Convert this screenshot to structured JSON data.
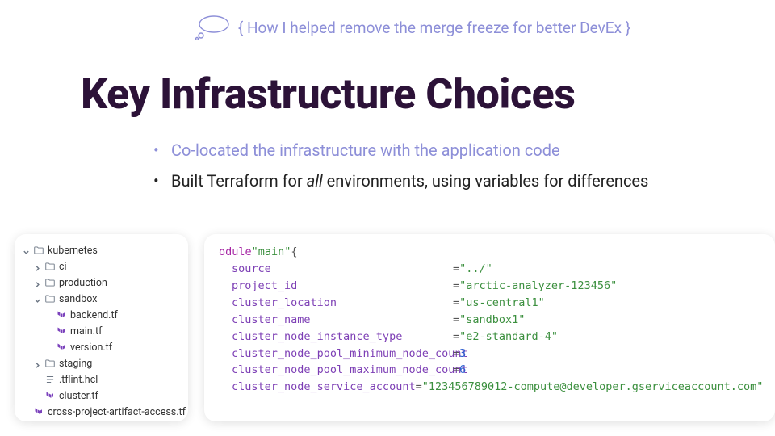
{
  "subtitle": "{ How I helped remove the merge freeze for better DevEx }",
  "title": "Key Infrastructure Choices",
  "bullets": [
    {
      "text": "Co-located the infrastructure with the application code",
      "muted": true
    },
    {
      "html": "Built Terraform for <em>all</em> environments, using variables for differences",
      "muted": false
    }
  ],
  "tree": [
    {
      "depth": 0,
      "chev": "down",
      "icon": "folder",
      "label": "kubernetes"
    },
    {
      "depth": 1,
      "chev": "right",
      "icon": "folder",
      "label": "ci"
    },
    {
      "depth": 1,
      "chev": "right",
      "icon": "folder",
      "label": "production"
    },
    {
      "depth": 1,
      "chev": "down",
      "icon": "folder",
      "label": "sandbox"
    },
    {
      "depth": 2,
      "chev": "",
      "icon": "tf",
      "label": "backend.tf"
    },
    {
      "depth": 2,
      "chev": "",
      "icon": "tf",
      "label": "main.tf"
    },
    {
      "depth": 2,
      "chev": "",
      "icon": "tf",
      "label": "version.tf"
    },
    {
      "depth": 1,
      "chev": "right",
      "icon": "folder",
      "label": "staging"
    },
    {
      "depth": 1,
      "chev": "",
      "icon": "lines",
      "label": ".tflint.hcl"
    },
    {
      "depth": 1,
      "chev": "",
      "icon": "tf",
      "label": "cluster.tf"
    },
    {
      "depth": 1,
      "chev": "",
      "icon": "tf",
      "label": "cross-project-artifact-access.tf"
    }
  ],
  "code": {
    "header": {
      "keyword": "odule",
      "name": "\"main\"",
      "brace": " {"
    },
    "attrs": [
      {
        "key": "source",
        "val": "\"../\"",
        "type": "str"
      },
      {
        "key": "project_id",
        "val": "\"arctic-analyzer-123456\"",
        "type": "str"
      },
      {
        "key": "cluster_location",
        "val": "\"us-central1\"",
        "type": "str"
      },
      {
        "key": "cluster_name",
        "val": "\"sandbox1\"",
        "type": "str"
      },
      {
        "key": "cluster_node_instance_type",
        "val": "\"e2-standard-4\"",
        "type": "str"
      },
      {
        "key": "cluster_node_pool_minimum_node_count",
        "val": "3",
        "type": "num"
      },
      {
        "key": "cluster_node_pool_maximum_node_count",
        "val": "6",
        "type": "num"
      },
      {
        "key": "cluster_node_service_account",
        "val": "\"123456789012-compute@developer.gserviceaccount.com\"",
        "type": "str"
      }
    ]
  }
}
